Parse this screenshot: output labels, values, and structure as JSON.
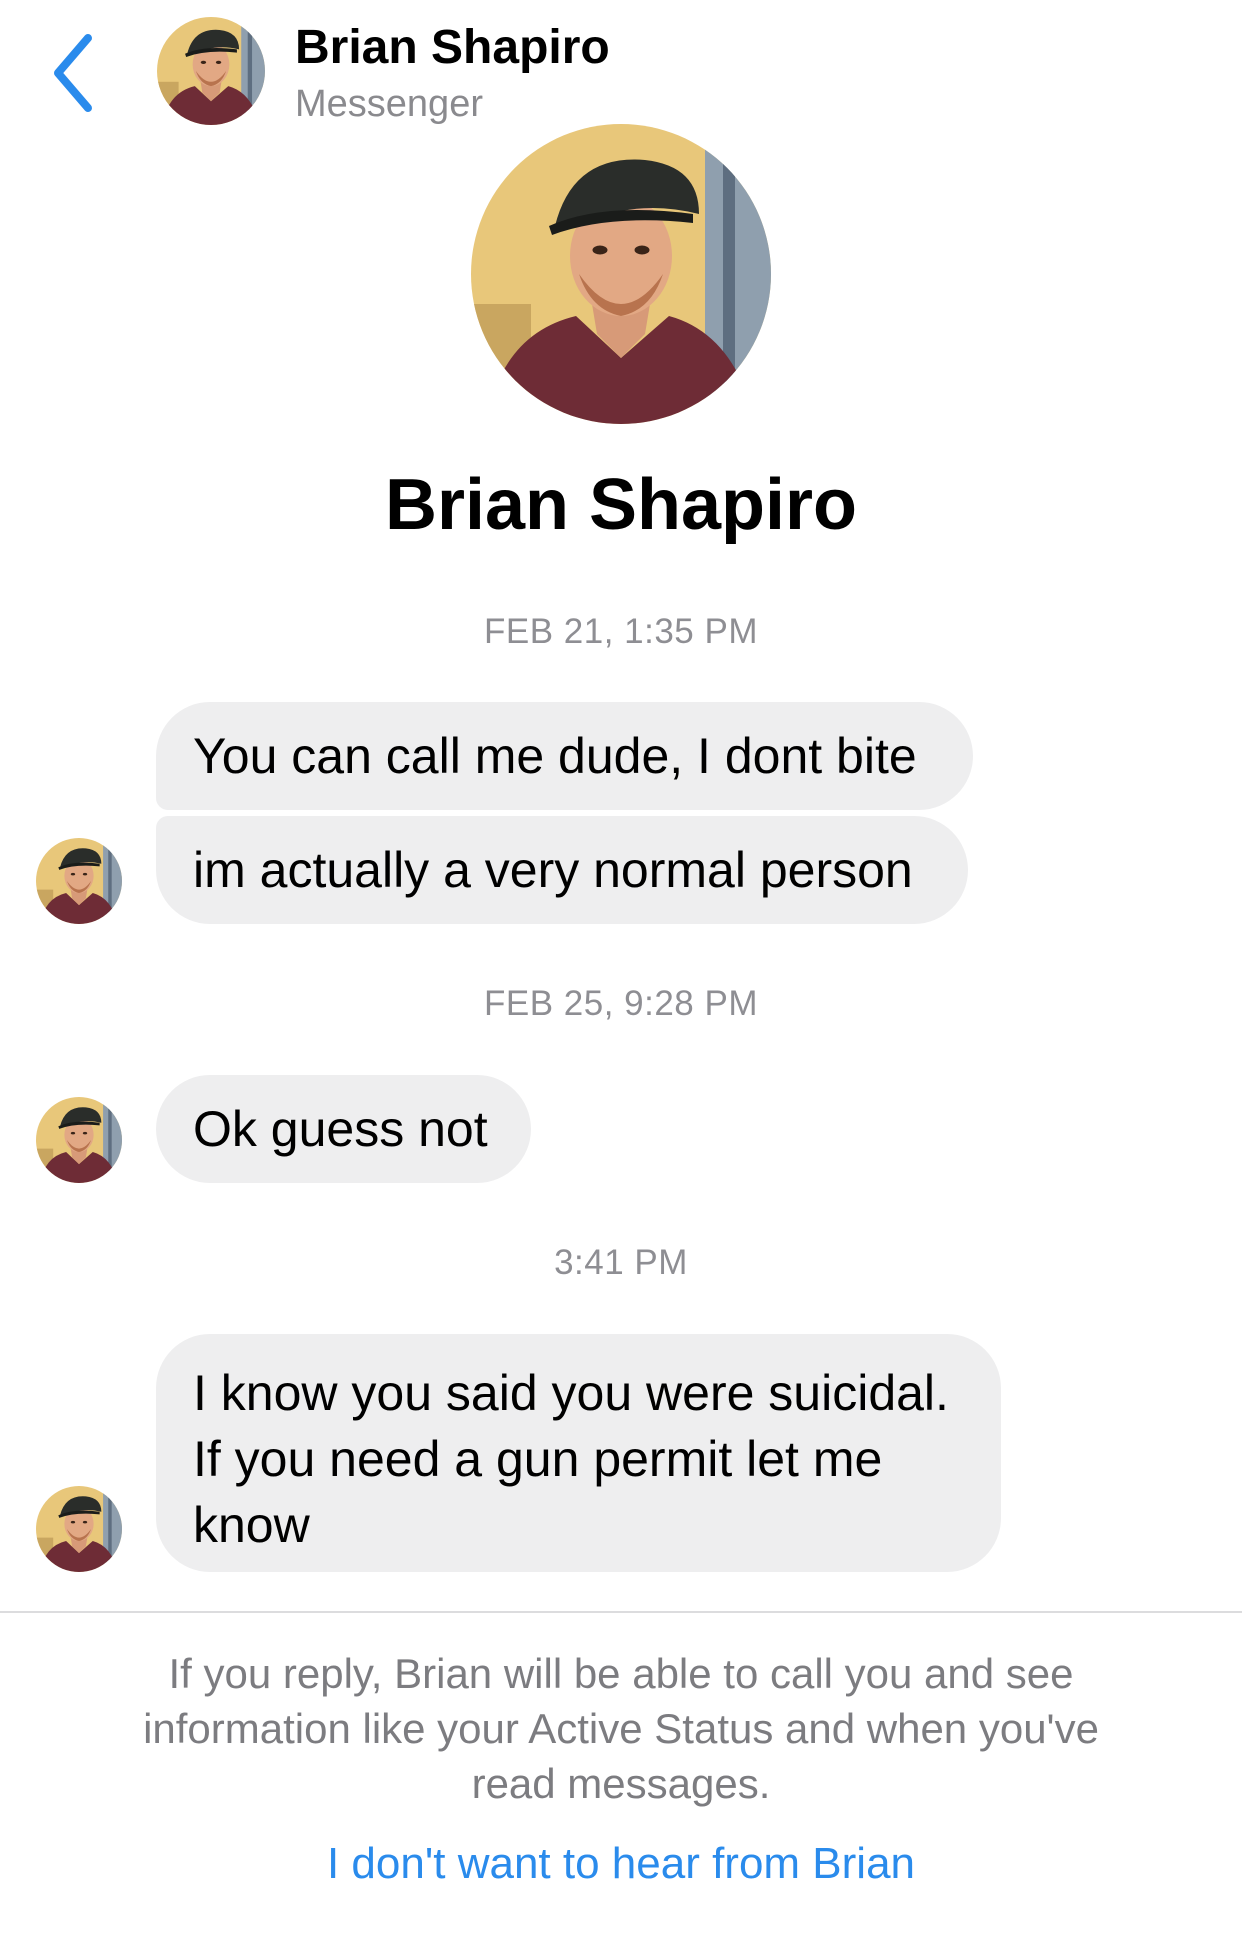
{
  "header": {
    "contact_name": "Brian Shapiro",
    "subtitle": "Messenger"
  },
  "profile": {
    "name": "Brian Shapiro"
  },
  "thread": {
    "timestamps": [
      "FEB 21, 1:35 PM",
      "FEB 25, 9:28 PM",
      "3:41 PM"
    ],
    "messages": [
      {
        "lines": [
          "You can call me dude, I dont bite"
        ]
      },
      {
        "lines": [
          "im actually a very normal person"
        ]
      },
      {
        "lines": [
          "Ok guess not"
        ]
      },
      {
        "lines": [
          "I know you said you were suicidal.",
          "If you need a gun permit let me",
          "know"
        ]
      }
    ]
  },
  "footer": {
    "notice_lines": [
      "If you reply, Brian will be able to call you and see",
      "information like your Active Status and when you've",
      "read messages."
    ],
    "optout_link": "I don't want to hear from Brian"
  },
  "colors": {
    "accent_blue": "#2a8bec",
    "bubble_gray": "#eeeeef",
    "muted_text": "#8e8e93"
  },
  "icons": {
    "back": "chevron-left-icon"
  }
}
